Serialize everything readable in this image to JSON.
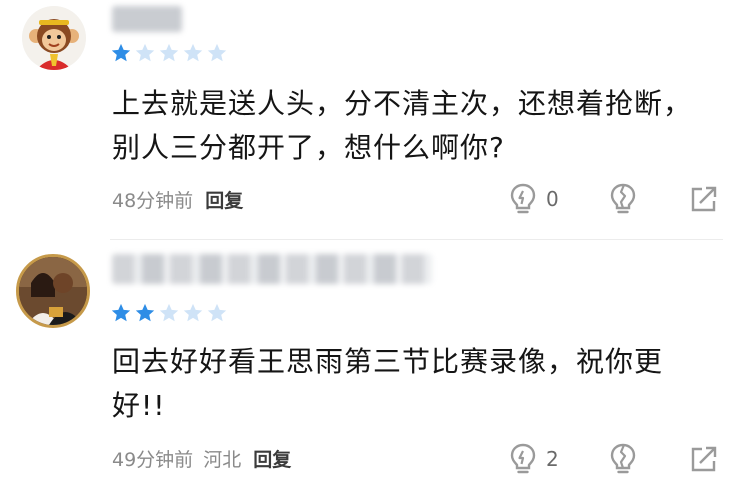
{
  "comments": [
    {
      "rating": 1,
      "max_rating": 5,
      "text": "上去就是送人头，分不清主次，还想着抢断，别人三分都开了，想什么啊你?",
      "time": "48分钟前",
      "region": "",
      "reply_label": "回复",
      "like_count": "0"
    },
    {
      "rating": 2,
      "max_rating": 5,
      "text": "回去好好看王思雨第三节比赛录像，祝你更好!!",
      "time": "49分钟前",
      "region": "河北",
      "reply_label": "回复",
      "like_count": "2"
    }
  ],
  "colors": {
    "star_filled": "#2e8de6",
    "star_empty": "#cfe3f7",
    "icon_gray": "#9a9a9a"
  }
}
